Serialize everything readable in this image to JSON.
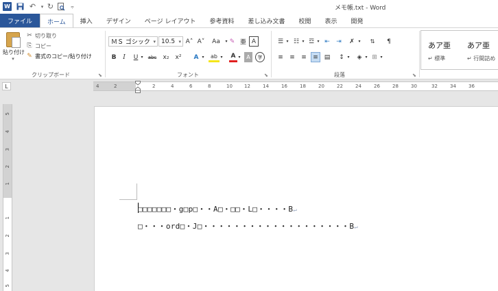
{
  "titlebar": {
    "app_icon": "W",
    "undo": "↶",
    "redo": "↻",
    "print_preview": "🔍",
    "customize": "₹",
    "title": "メモ帳.txt - Word"
  },
  "tabs": [
    "ファイル",
    "ホーム",
    "挿入",
    "デザイン",
    "ページ レイアウト",
    "参考資料",
    "差し込み文書",
    "校閲",
    "表示",
    "開発"
  ],
  "clipboard": {
    "paste": "貼り付け",
    "cut": "切り取り",
    "copy": "コピー",
    "format_painter": "書式のコピー/貼り付け",
    "label": "クリップボード"
  },
  "font": {
    "name": "ＭＳ ゴシック",
    "size": "10.5",
    "grow": "A˄",
    "shrink": "A˅",
    "case": "Aa",
    "clear": "✎",
    "phonetic": "亜",
    "border": "A",
    "bold": "B",
    "italic": "I",
    "underline": "U",
    "strike": "abc",
    "subscript": "x₂",
    "superscript": "x²",
    "effects": "A",
    "highlight": "ab",
    "color": "A",
    "shading": "A",
    "enclose": "字",
    "label": "フォント"
  },
  "paragraph": {
    "label": "段落"
  },
  "styles": [
    {
      "sample": "あア亜",
      "name": "↵ 標準"
    },
    {
      "sample": "あア亜",
      "name": "↵ 行間詰め"
    }
  ],
  "ruler": {
    "corner": "L",
    "ticks": [
      "4",
      "2",
      "2",
      "4",
      "6",
      "8",
      "10",
      "12",
      "14",
      "16",
      "18",
      "20",
      "22",
      "24",
      "26",
      "28",
      "30",
      "32",
      "34",
      "36"
    ]
  },
  "vruler": {
    "ticks": [
      "5",
      "4",
      "3",
      "2",
      "1",
      "1",
      "2",
      "3",
      "4",
      "5"
    ]
  },
  "document": {
    "line1": "□□□□□□□・g□p□・・A□・□□・L□・・・・B",
    "line2": "□・・・ord□・J□・・・・・・・・・・・・・・・・・・・B",
    "pilcrow": "↵"
  }
}
